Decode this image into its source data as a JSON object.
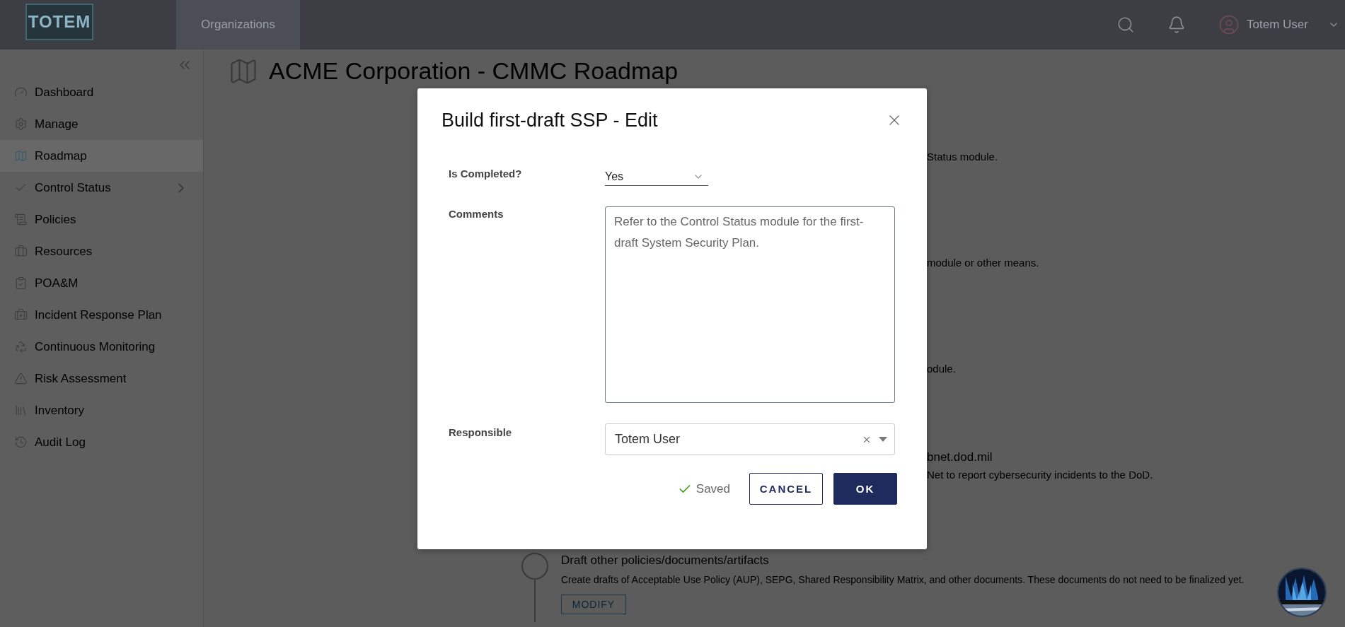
{
  "topbar": {
    "logo": "TOTEM",
    "nav_tabs": [
      {
        "label": "Organizations",
        "selected": true
      }
    ],
    "user": {
      "name": "Totem User"
    }
  },
  "sidebar": {
    "items": [
      {
        "label": "Dashboard",
        "selected": false
      },
      {
        "label": "Manage",
        "selected": false
      },
      {
        "label": "Roadmap",
        "selected": true
      },
      {
        "label": "Control Status",
        "selected": false,
        "expanded": false
      },
      {
        "label": "Policies",
        "selected": false
      },
      {
        "label": "Resources",
        "selected": false
      },
      {
        "label": "POA&M",
        "selected": false
      },
      {
        "label": "Incident Response Plan",
        "selected": false
      },
      {
        "label": "Continuous Monitoring",
        "selected": false
      },
      {
        "label": "Risk Assessment",
        "selected": false
      },
      {
        "label": "Inventory",
        "selected": false
      },
      {
        "label": "Audit Log",
        "selected": false
      }
    ]
  },
  "page": {
    "title": "ACME Corporation - CMMC Roadmap",
    "step_fragments": [
      {
        "description": "Status module."
      },
      {
        "description": "module or other means."
      },
      {
        "description": "odule."
      },
      {
        "title": "bnet.dod.mil",
        "description": "Net to report cybersecurity incidents to the DoD."
      }
    ],
    "steps": [
      {
        "title": "Draft other policies/documents/artifacts",
        "description": "Create drafts of Acceptable Use Policy (AUP), SEPG, Shared Responsibility Matrix, and other documents. These documents do not need to be finalized yet.",
        "action": "MODIFY",
        "completed": false
      }
    ]
  },
  "modal": {
    "title": "Build first-draft SSP - Edit",
    "fields": [
      {
        "kind": "select",
        "label": "Is Completed?",
        "value": "Yes"
      },
      {
        "kind": "textarea",
        "label": "Comments",
        "value": "Refer to the Control Status module for the first-draft System Security Plan."
      },
      {
        "kind": "combo",
        "label": "Responsible",
        "value": "Totem User"
      }
    ],
    "status": "Saved",
    "buttons": [
      {
        "label": "CANCEL",
        "kind": "secondary"
      },
      {
        "label": "OK",
        "kind": "primary"
      }
    ]
  }
}
